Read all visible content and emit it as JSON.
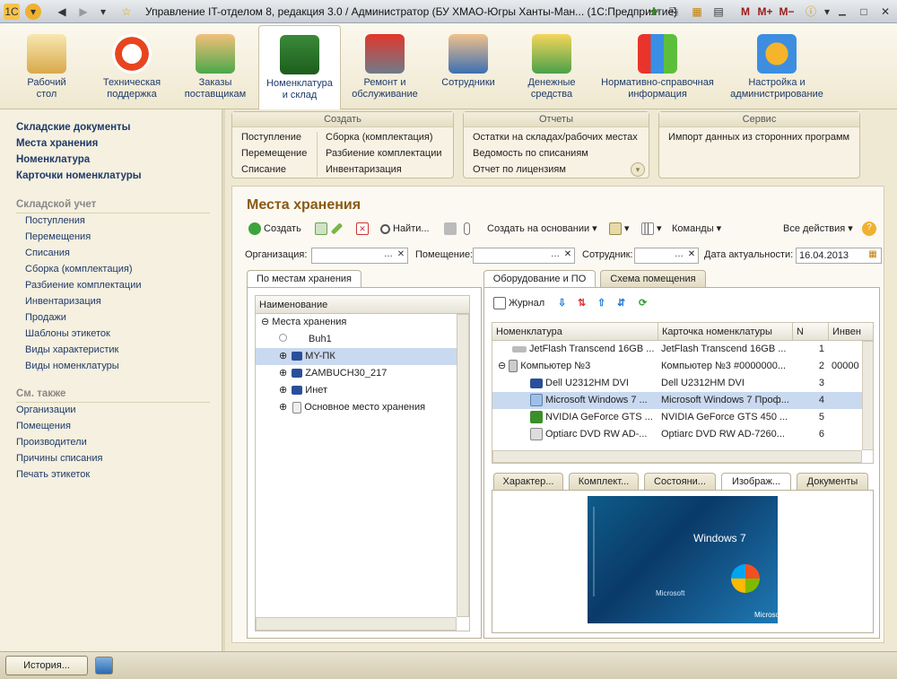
{
  "window": {
    "title": "Управление IT-отделом 8, редакция 3.0 / Администратор (БУ ХМАО-Югры Ханты-Ман... (1С:Предприятие)",
    "mbtns": [
      "M",
      "M+",
      "M−"
    ]
  },
  "sections": [
    {
      "label": "Рабочий\nстол",
      "icon": "desk-icon"
    },
    {
      "label": "Техническая\nподдержка",
      "icon": "lifebuoy-icon"
    },
    {
      "label": "Заказы\nпоставщикам",
      "icon": "order-icon"
    },
    {
      "label": "Номенклатура\nи склад",
      "icon": "card-icon"
    },
    {
      "label": "Ремонт и\nобслуживание",
      "icon": "repair-icon"
    },
    {
      "label": "Сотрудники",
      "icon": "people-icon"
    },
    {
      "label": "Денежные\nсредства",
      "icon": "money-icon"
    },
    {
      "label": "Нормативно-справочная\nинформация",
      "icon": "hierarchy-icon"
    },
    {
      "label": "Настройка и\nадминистрирование",
      "icon": "gears-icon"
    }
  ],
  "left": {
    "main": [
      "Складские документы",
      "Места хранения",
      "Номенклатура",
      "Карточки номенклатуры"
    ],
    "header1": "Складской учет",
    "items1": [
      "Поступления",
      "Перемещения",
      "Списания",
      "Сборка (комплектация)",
      "Разбиение комплектации",
      "Инвентаризация",
      "Продажи",
      "Шаблоны этикеток",
      "Виды характеристик",
      "Виды номенклатуры"
    ],
    "header2": "См. также",
    "items2": [
      "Организации",
      "Помещения",
      "Производители",
      "Причины списания",
      "Печать этикеток"
    ]
  },
  "groups": {
    "create": {
      "title": "Создать",
      "col1": [
        "Поступление",
        "Перемещение",
        "Списание"
      ],
      "col2": [
        "Сборка (комплектация)",
        "Разбиение комплектации",
        "Инвентаризация"
      ]
    },
    "reports": {
      "title": "Отчеты",
      "items": [
        "Остатки на складах/рабочих местах",
        "Ведомость по списаниям",
        "Отчет по лицензиям"
      ]
    },
    "service": {
      "title": "Сервис",
      "items": [
        "Импорт данных из сторонних программ"
      ]
    }
  },
  "form": {
    "title": "Места хранения",
    "toolbar": {
      "create": "Создать",
      "find": "Найти...",
      "create_based": "Создать на основании",
      "commands": "Команды",
      "all_actions": "Все действия"
    },
    "filters": {
      "org_label": "Организация:",
      "room_label": "Помещение:",
      "emp_label": "Сотрудник:",
      "date_label": "Дата актуальности:",
      "date_value": "16.04.2013"
    },
    "left_tab": "По местам хранения",
    "tree_header": "Наименование",
    "tree": [
      {
        "label": "Места хранения"
      },
      {
        "label": "Buh1"
      },
      {
        "label": "MY-ПК"
      },
      {
        "label": "ZAMBUCH30_217"
      },
      {
        "label": "Инет"
      },
      {
        "label": "Основное место хранения"
      }
    ],
    "right_tabs": [
      "Оборудование и ПО",
      "Схема помещения"
    ],
    "journal": "Журнал",
    "grid_headers": [
      "Номенклатура",
      "Карточка номенклатуры",
      "N",
      "Инвен"
    ],
    "grid_rows": [
      {
        "name": "JetFlash Transcend 16GB ...",
        "card": "JetFlash Transcend 16GB ...",
        "n": "1",
        "inv": ""
      },
      {
        "name": "Компьютер №3",
        "card": "Компьютер №3 #0000000...",
        "n": "2",
        "inv": "00000"
      },
      {
        "name": "Dell U2312HM DVI",
        "card": "Dell U2312HM DVI",
        "n": "3",
        "inv": ""
      },
      {
        "name": "Microsoft Windows 7 ...",
        "card": "Microsoft Windows 7 Проф...",
        "n": "4",
        "inv": ""
      },
      {
        "name": "NVIDIA GeForce GTS ...",
        "card": "NVIDIA GeForce GTS 450 ...",
        "n": "5",
        "inv": ""
      },
      {
        "name": "Optiarc DVD RW AD-...",
        "card": "Optiarc DVD RW AD-7260...",
        "n": "6",
        "inv": ""
      }
    ],
    "bottom_tabs": [
      "Характер...",
      "Комплект...",
      "Состояни...",
      "Изображ...",
      "Документы"
    ],
    "image_text": {
      "brand": "Windows 7",
      "vendor": "Microsoft",
      "vertical": "Windows 7"
    }
  },
  "statusbar": {
    "history": "История..."
  },
  "colors": {
    "accent": "#8a5a14",
    "link": "#1e3a6a",
    "selection": "#c9d9ef"
  }
}
